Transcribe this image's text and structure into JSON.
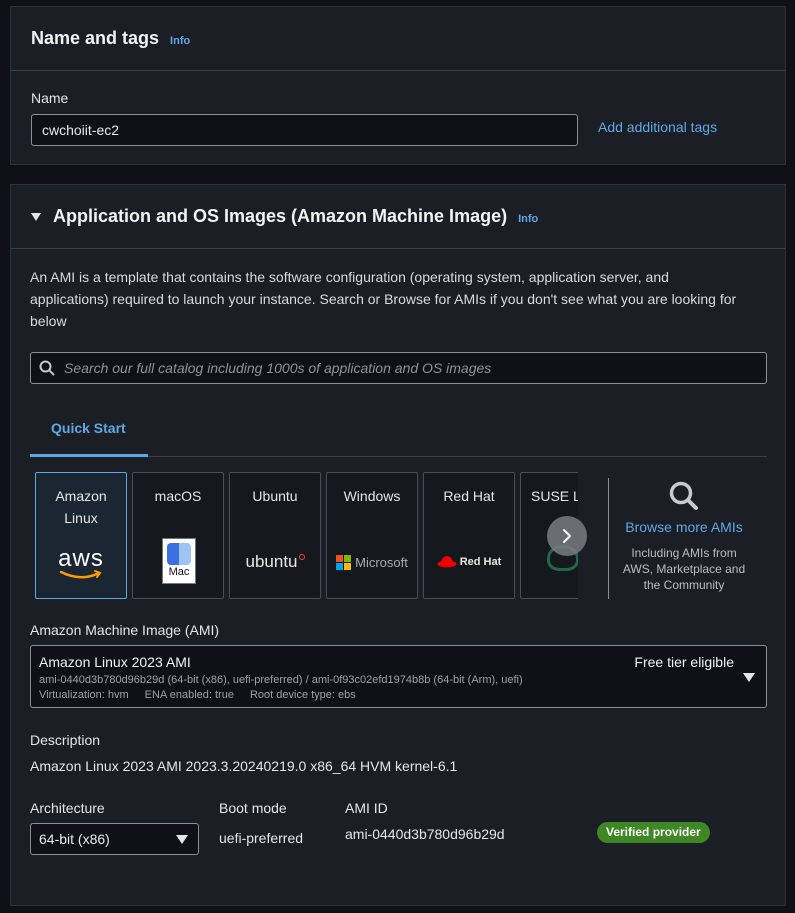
{
  "name_tags": {
    "title": "Name and tags",
    "info": "Info",
    "name_label": "Name",
    "name_value": "cwchoiit-ec2",
    "add_tags_link": "Add additional tags"
  },
  "ami_section": {
    "title": "Application and OS Images (Amazon Machine Image)",
    "info": "Info",
    "description_line1": "An AMI is a template that contains the software configuration (operating system, application server, and",
    "description_line2": "applications) required to launch your instance. Search or Browse for AMIs if you don't see what you are looking for",
    "description_line3": "below",
    "search_placeholder": "Search our full catalog including 1000s of application and OS images",
    "tab_quick_start": "Quick Start",
    "tiles": [
      {
        "label_line1": "Amazon",
        "label_line2": "Linux",
        "logo": "aws"
      },
      {
        "label_line1": "macOS",
        "label_line2": "",
        "logo": "Mac"
      },
      {
        "label_line1": "Ubuntu",
        "label_line2": "",
        "logo": "ubuntu"
      },
      {
        "label_line1": "Windows",
        "label_line2": "",
        "logo": "Microsoft"
      },
      {
        "label_line1": "Red Hat",
        "label_line2": "",
        "logo": "Red Hat"
      },
      {
        "label_line1": "SUSE Li",
        "label_line2": "",
        "logo": "suse"
      }
    ],
    "browse_more": {
      "link": "Browse more AMIs",
      "sub1": "Including AMIs from",
      "sub2": "AWS, Marketplace and",
      "sub3": "the Community"
    },
    "ami_label": "Amazon Machine Image (AMI)",
    "ami_select": {
      "name": "Amazon Linux 2023 AMI",
      "ids": "ami-0440d3b780d96b29d (64-bit (x86), uefi-preferred) / ami-0f93c02efd1974b8b (64-bit (Arm), uefi)",
      "virtualization": "Virtualization: hvm",
      "ena": "ENA enabled: true",
      "root_device": "Root device type: ebs",
      "free_tier": "Free tier eligible"
    },
    "description_label": "Description",
    "description_value": "Amazon Linux 2023 AMI 2023.3.20240219.0 x86_64 HVM kernel-6.1",
    "architecture_label": "Architecture",
    "architecture_value": "64-bit (x86)",
    "boot_mode_label": "Boot mode",
    "boot_mode_value": "uefi-preferred",
    "ami_id_label": "AMI ID",
    "ami_id_value": "ami-0440d3b780d96b29d",
    "verified_badge": "Verified provider"
  },
  "colors": {
    "accent": "#5fa8e8",
    "badge": "#3f8624",
    "panel": "#1b1e24"
  }
}
